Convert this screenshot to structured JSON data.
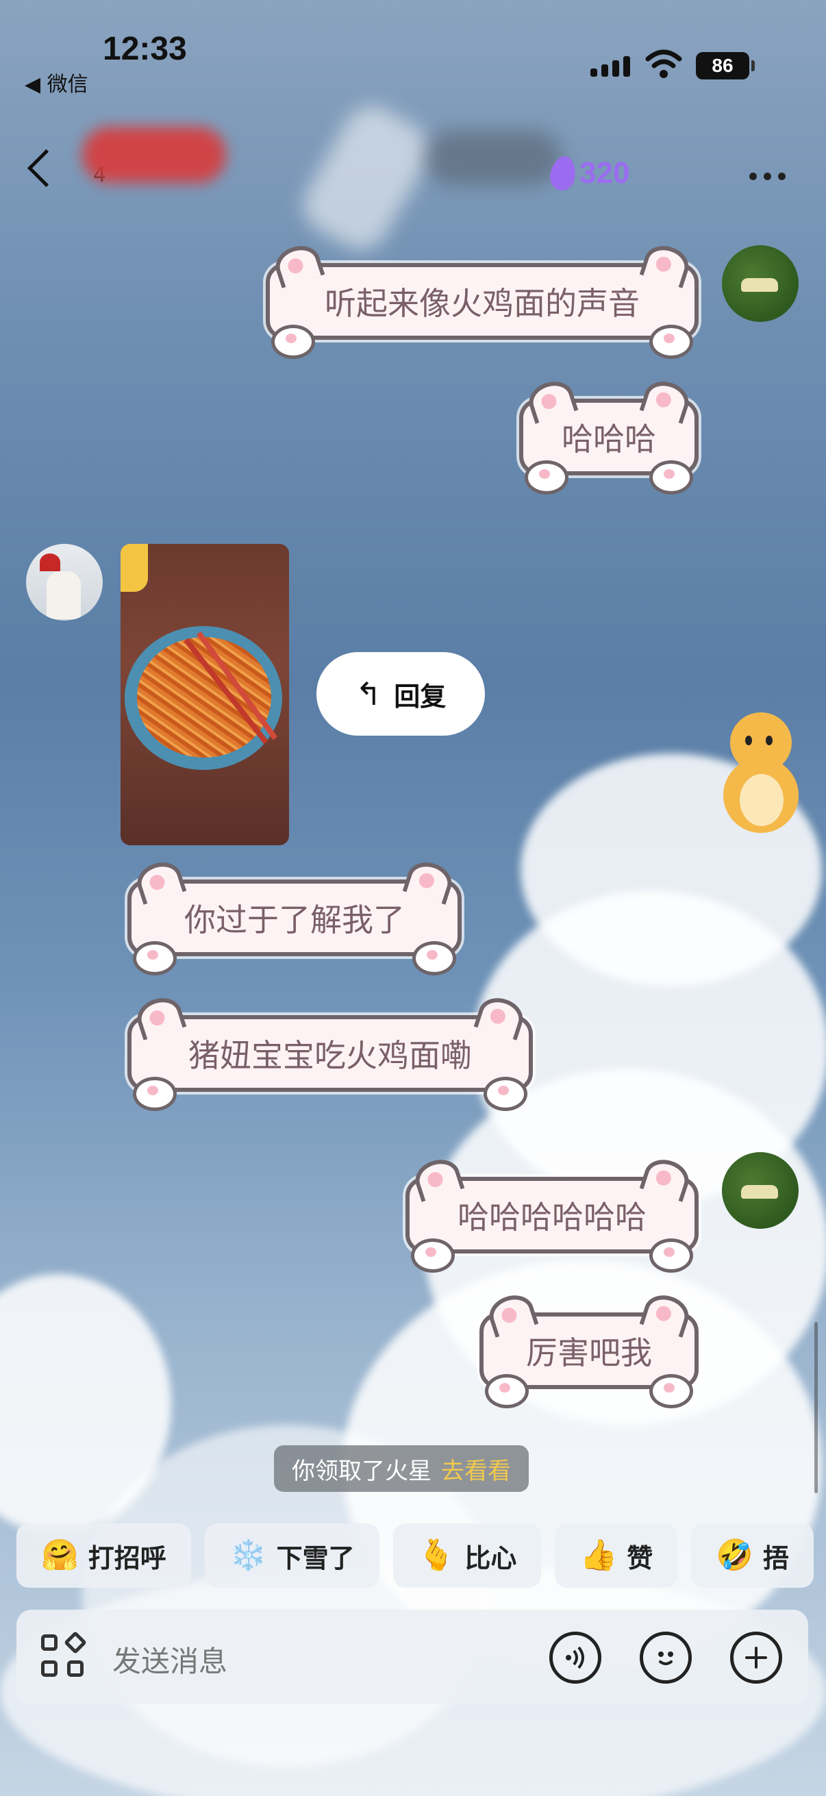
{
  "status_bar": {
    "time": "12:33",
    "back_app": "◀ 微信",
    "battery": "86"
  },
  "nav": {
    "count": "4",
    "fire_count": "320"
  },
  "messages": [
    {
      "side": "right",
      "text": "听起来像火鸡面的声音"
    },
    {
      "side": "right",
      "text": "哈哈哈"
    },
    {
      "side": "left",
      "type": "image",
      "alt_icon": "noodle-photo"
    },
    {
      "side": "left",
      "text": "你过于了解我了"
    },
    {
      "side": "left",
      "text": "猪妞宝宝吃火鸡面嘞"
    },
    {
      "side": "right",
      "text": "哈哈哈哈哈哈"
    },
    {
      "side": "right",
      "text": "厉害吧我"
    }
  ],
  "reply_chip": {
    "label": "回复",
    "icon": "reply-arrow-icon"
  },
  "notice": {
    "text": "你领取了火星",
    "action": "去看看"
  },
  "quick_replies": [
    {
      "icon": "🤗",
      "label": "打招呼"
    },
    {
      "icon": "❄️",
      "label": "下雪了"
    },
    {
      "icon": "🫰",
      "label": "比心"
    },
    {
      "icon": "👍",
      "label": "赞"
    },
    {
      "icon": "🤣",
      "label": "捂"
    }
  ],
  "input": {
    "placeholder": "发送消息"
  },
  "colors": {
    "bubble_fill": "#fdf3f5",
    "bubble_border": "#6e6469",
    "bubble_text": "#7a6068",
    "fire": "#9b6cf0",
    "notice_action": "#f2c94c"
  }
}
